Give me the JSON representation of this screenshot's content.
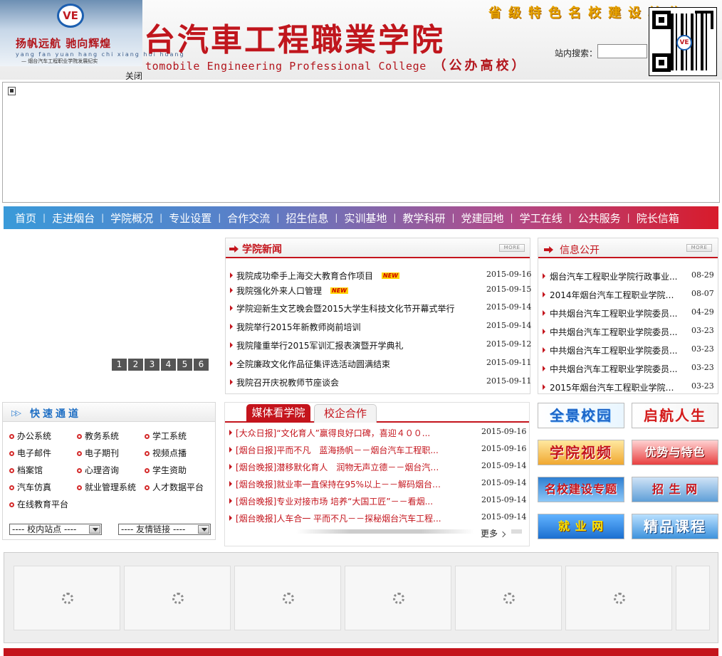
{
  "header": {
    "brand_slogan": "扬帆远航  驰向辉煌",
    "brand_sub": "yang fan yuan hang  chi xiang hui huang",
    "brand_sub2": "— 烟台汽车工程职业学院发展纪实",
    "logo_text": "VE",
    "close_label": "关闭",
    "college_name_cn": "台汽車工程職業学院",
    "college_name_en": "tomobile Engineering Professional College",
    "public_label": "（公办高校）",
    "feature_banner": "省级特色名校建设单位",
    "search_label": "站内搜索：",
    "search_value": ""
  },
  "nav": {
    "items": [
      "首页",
      "走进烟台",
      "学院概况",
      "专业设置",
      "合作交流",
      "招生信息",
      "实训基地",
      "教学科研",
      "党建园地",
      "学工在线",
      "公共服务",
      "院长信箱"
    ]
  },
  "slider": {
    "pages": [
      "1",
      "2",
      "3",
      "4",
      "5",
      "6"
    ]
  },
  "news": {
    "title": "学院新闻",
    "more": "MORE",
    "new_badge": "NEW",
    "items": [
      {
        "title": "我院成功牵手上海交大教育合作项目",
        "date": "2015-09-16",
        "new": true
      },
      {
        "title": "我院强化外来人口管理",
        "date": "2015-09-15",
        "new": true
      },
      {
        "title": "学院迎新生文艺晚会暨2015大学生科技文化节开幕式举行",
        "date": "2015-09-14"
      },
      {
        "title": "我院举行2015年新教师岗前培训",
        "date": "2015-09-14"
      },
      {
        "title": "我院隆重举行2015军训汇报表演暨开学典礼",
        "date": "2015-09-12"
      },
      {
        "title": "全院廉政文化作品征集评选活动圆满结束",
        "date": "2015-09-11"
      },
      {
        "title": "我院召开庆祝教师节座谈会",
        "date": "2015-09-11"
      }
    ]
  },
  "info": {
    "title": "信息公开",
    "more": "MORE",
    "items": [
      {
        "title": "烟台汽车工程职业学院行政事业...",
        "date": "08-29"
      },
      {
        "title": "2014年烟台汽车工程职业学院部...",
        "date": "08-07"
      },
      {
        "title": "中共烟台汽车工程职业学院委员...",
        "date": "04-29"
      },
      {
        "title": "中共烟台汽车工程职业学院委员...",
        "date": "03-23"
      },
      {
        "title": "中共烟台汽车工程职业学院委员...",
        "date": "03-23"
      },
      {
        "title": "中共烟台汽车工程职业学院委员...",
        "date": "03-23"
      },
      {
        "title": "2015年烟台汽车工程职业学院收...",
        "date": "03-23"
      }
    ]
  },
  "quick": {
    "title": "快速通道",
    "items": [
      "办公系统",
      "教务系统",
      "学工系统",
      "电子邮件",
      "电子期刊",
      "视频点播",
      "档案馆",
      "心理咨询",
      "学生资助",
      "汽车仿真",
      "就业管理系统",
      "人才数据平台",
      "在线教育平台"
    ],
    "select_site": "---- 校内站点 ----",
    "select_links": "---- 友情链接 ----"
  },
  "media": {
    "tab_active": "媒体看学院",
    "tab_inactive": "校企合作",
    "more": "更多",
    "items": [
      {
        "title": "[大众日报]“文化育人”赢得良好口碑，喜迎４００...",
        "date": "2015-09-16"
      },
      {
        "title": "[烟台日报]平而不凡　蓝海扬帆－－烟台汽车工程职...",
        "date": "2015-09-16"
      },
      {
        "title": "[烟台晚报]潜移默化育人　润物无声立德－－烟台汽车...",
        "date": "2015-09-14"
      },
      {
        "title": "[烟台晚报]就业率一直保持在95%以上－－解码烟台汽...",
        "date": "2015-09-14"
      },
      {
        "title": "[烟台晚报]专业对接市场 培养“大国工匠”－－看烟...",
        "date": "2015-09-14"
      },
      {
        "title": "[烟台晚报]人车合一 平而不凡－－探秘烟台汽车工程...",
        "date": "2015-09-14"
      }
    ]
  },
  "banners": [
    "全景校园",
    "启航人生",
    "学院视频",
    "优势与特色",
    "名校建设专题",
    "招 生 网",
    "就 业 网",
    "精品课程"
  ],
  "gallery": {
    "count": 7
  }
}
